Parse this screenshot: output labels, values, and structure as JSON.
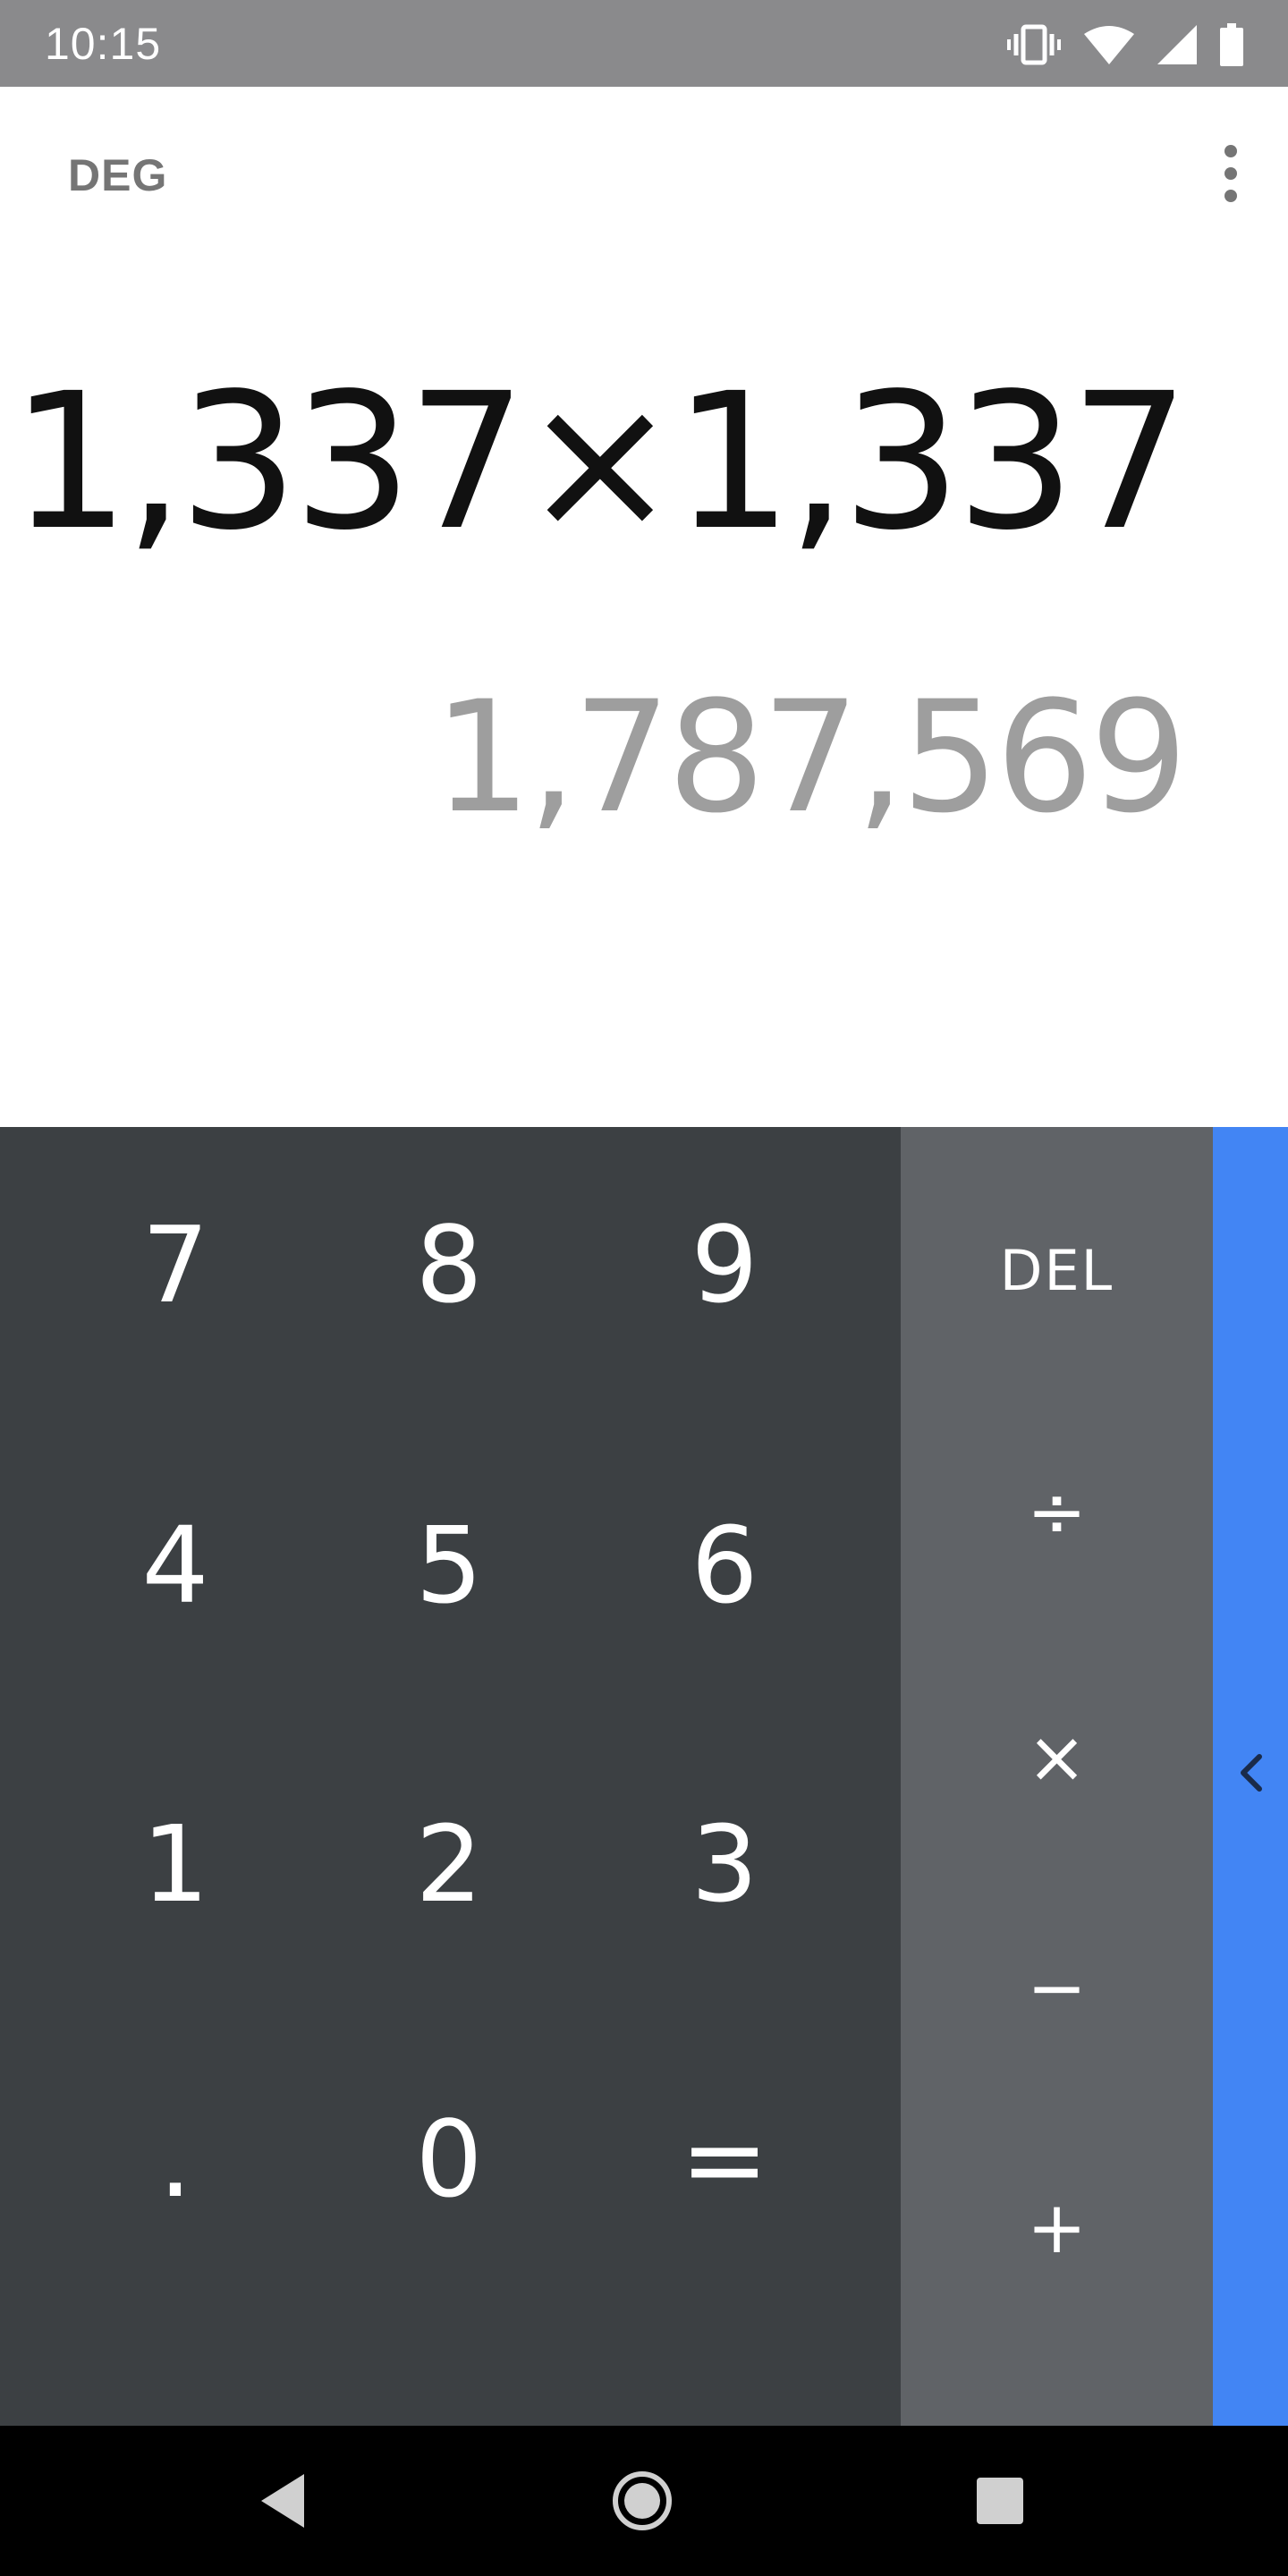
{
  "status_bar": {
    "time": "10:15",
    "icons": [
      "vibrate-icon",
      "wifi-icon",
      "cell-signal-icon",
      "battery-icon"
    ]
  },
  "display": {
    "mode": "DEG",
    "expression": "1,337×1,337",
    "result": "1,787,569"
  },
  "keypad": {
    "numbers": [
      [
        "7",
        "8",
        "9"
      ],
      [
        "4",
        "5",
        "6"
      ],
      [
        "1",
        "2",
        "3"
      ],
      [
        ".",
        "0",
        "="
      ]
    ],
    "operators": [
      "DEL",
      "÷",
      "×",
      "−",
      "+"
    ]
  },
  "colors": {
    "status_bar": "#8a8a8c",
    "numpad": "#3c4043",
    "operators": "#606367",
    "advanced_panel": "#4285f4",
    "result_text": "#9e9e9e"
  },
  "nav_bar": {
    "icons": [
      "back-icon",
      "home-icon",
      "recents-icon"
    ]
  }
}
